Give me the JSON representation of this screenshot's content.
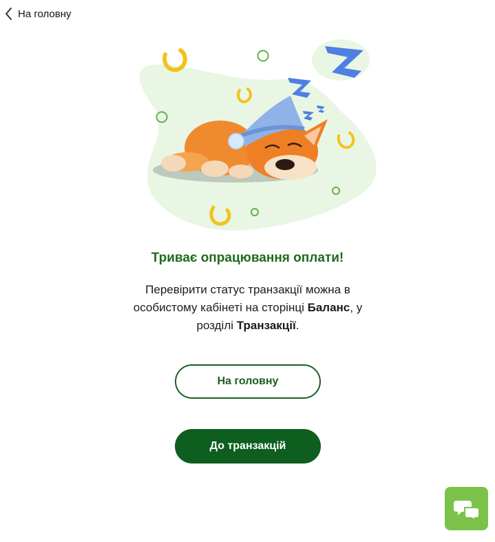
{
  "header": {
    "back_label": "На головну"
  },
  "status": {
    "title": "Триває опрацювання оплати!",
    "desc_part1": "Перевірити статус транзакції можна в особистому кабінеті на сторінці ",
    "desc_bold1": "Баланс",
    "desc_part2": ", у розділі ",
    "desc_bold2": "Транзакції",
    "desc_part3": "."
  },
  "actions": {
    "home_label": "На головну",
    "transactions_label": "До транзакцій"
  },
  "colors": {
    "brand_green": "#0d5e1f",
    "title_green": "#1f6a1e",
    "chat_green": "#7cc24a",
    "blob_green": "#e9f6e4"
  },
  "icons": {
    "back": "chevron-left-icon",
    "chat": "chat-bubbles-icon",
    "illustration": "sleeping-fox-illustration"
  }
}
